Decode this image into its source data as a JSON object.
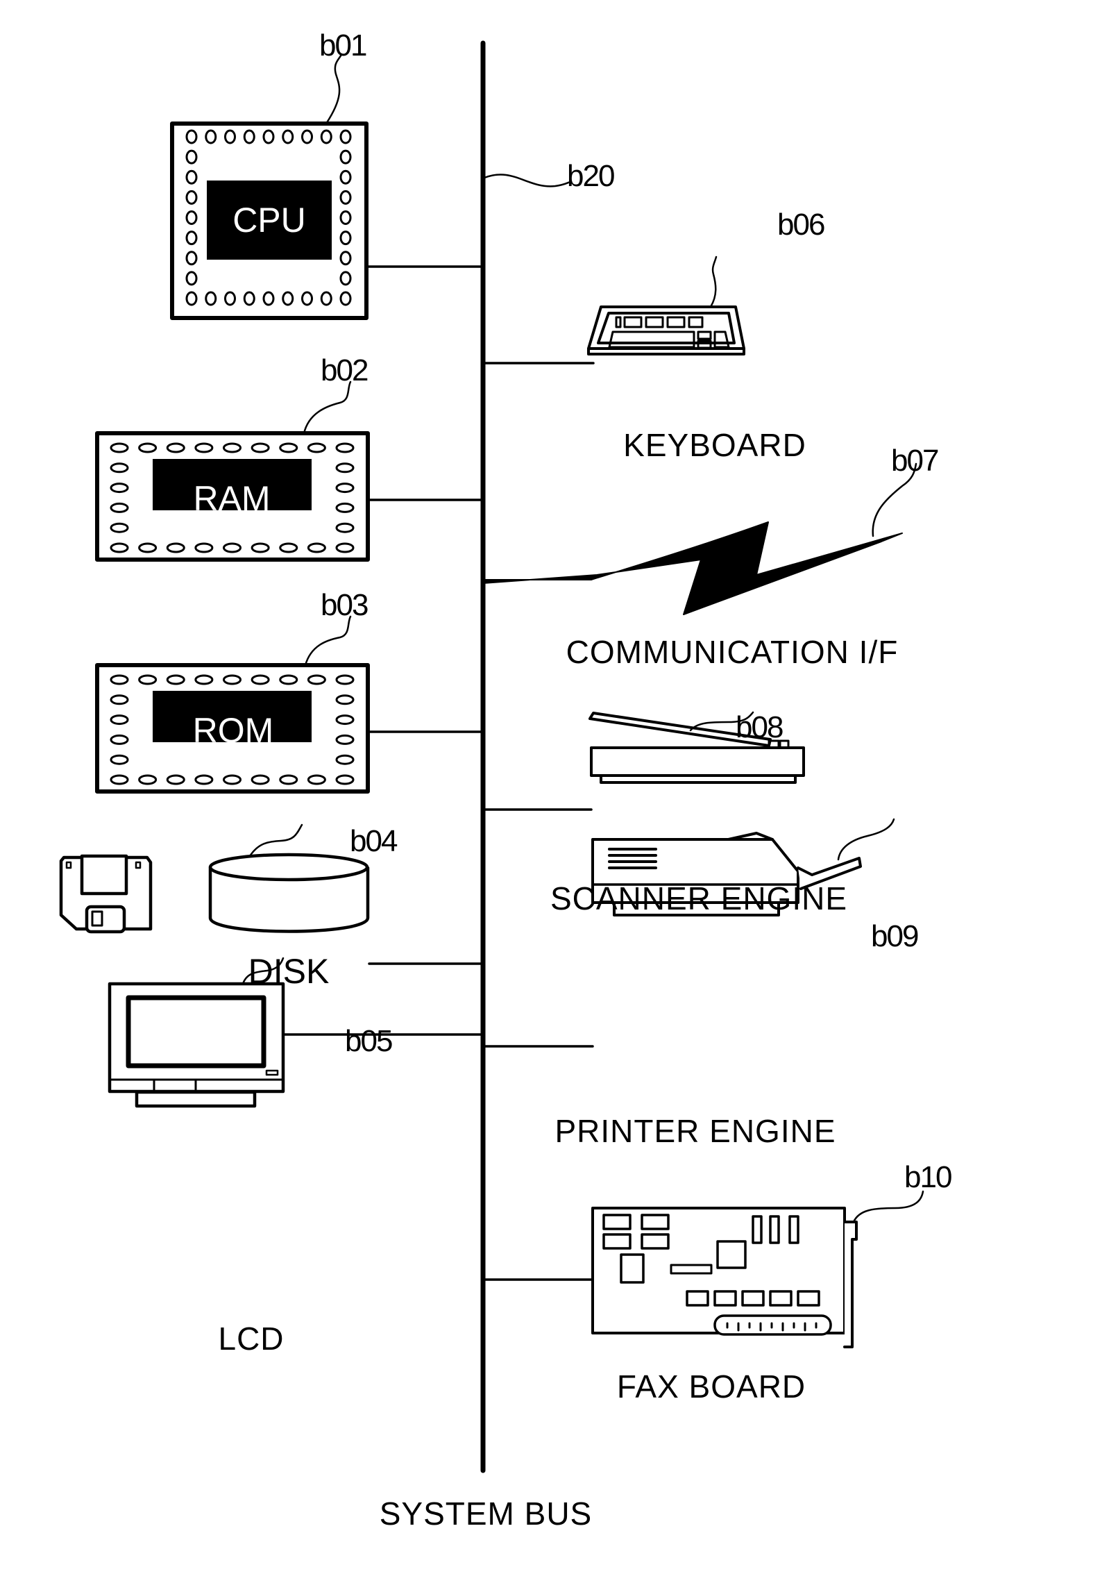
{
  "diagram": {
    "bus": {
      "ref": "b20",
      "caption": "SYSTEM BUS"
    },
    "components": [
      {
        "id": "cpu",
        "ref": "b01",
        "label": "CPU",
        "caption": ""
      },
      {
        "id": "ram",
        "ref": "b02",
        "label": "RAM",
        "caption": ""
      },
      {
        "id": "rom",
        "ref": "b03",
        "label": "ROM",
        "caption": ""
      },
      {
        "id": "disk",
        "ref": "b04",
        "label": "DISK",
        "caption": ""
      },
      {
        "id": "lcd",
        "ref": "b05",
        "label": "",
        "caption": "LCD"
      },
      {
        "id": "keyboard",
        "ref": "b06",
        "label": "",
        "caption": "KEYBOARD"
      },
      {
        "id": "communication",
        "ref": "b07",
        "label": "",
        "caption": "COMMUNICATION I/F"
      },
      {
        "id": "scanner",
        "ref": "b08",
        "label": "",
        "caption": "SCANNER ENGINE"
      },
      {
        "id": "printer",
        "ref": "b09",
        "label": "",
        "caption": "PRINTER ENGINE"
      },
      {
        "id": "fax",
        "ref": "b10",
        "label": "",
        "caption": "FAX BOARD"
      }
    ]
  }
}
